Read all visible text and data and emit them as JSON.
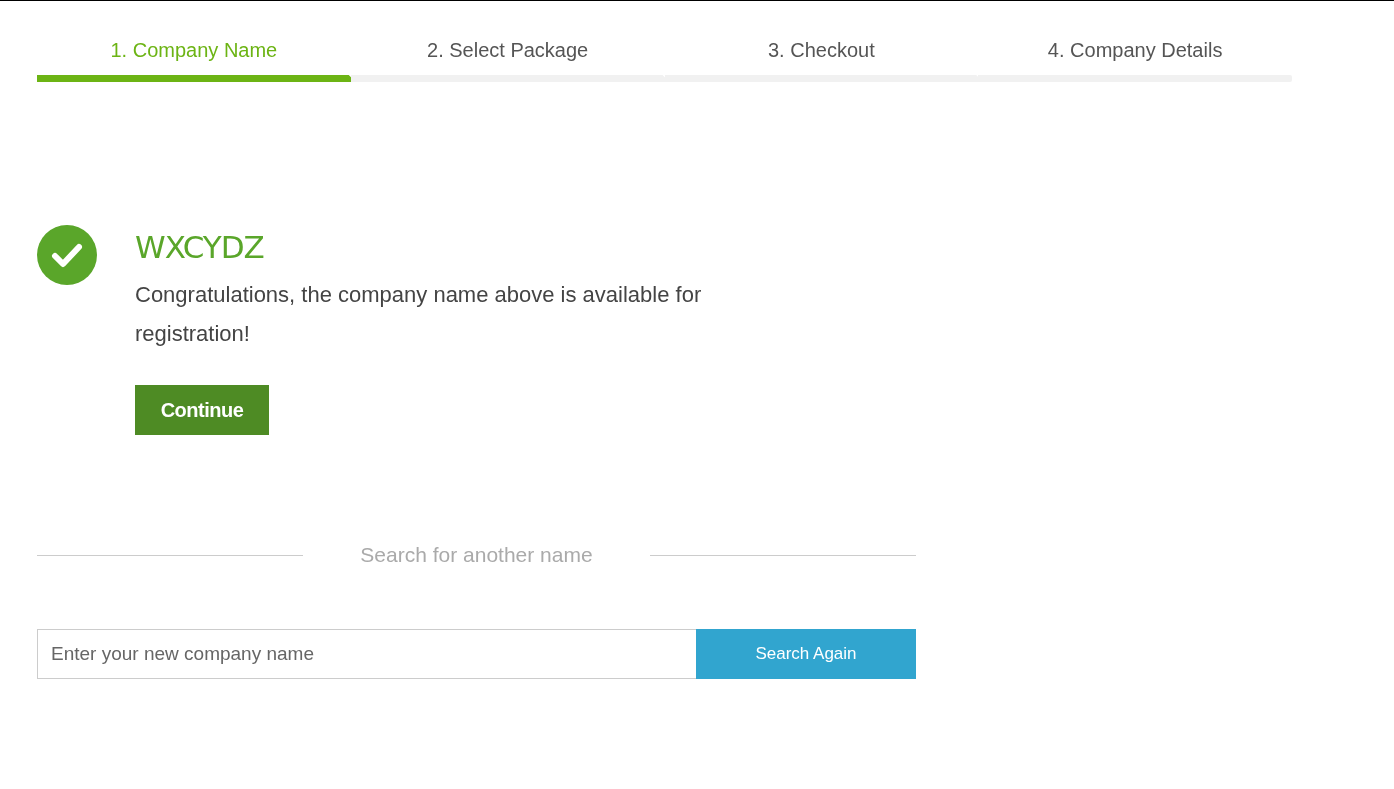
{
  "steps": [
    {
      "label": "1. Company Name",
      "selected": true
    },
    {
      "label": "2. Select Package",
      "selected": false
    },
    {
      "label": "3. Checkout",
      "selected": false
    },
    {
      "label": "4. Company Details",
      "selected": false
    }
  ],
  "result": {
    "name": "WXCYDZ",
    "message": "Congratulations, the company name above is available for registration!",
    "button": "Continue"
  },
  "search": {
    "heading": "Search for another name",
    "placeholder": "Enter your new company name",
    "button": "Search Again"
  }
}
